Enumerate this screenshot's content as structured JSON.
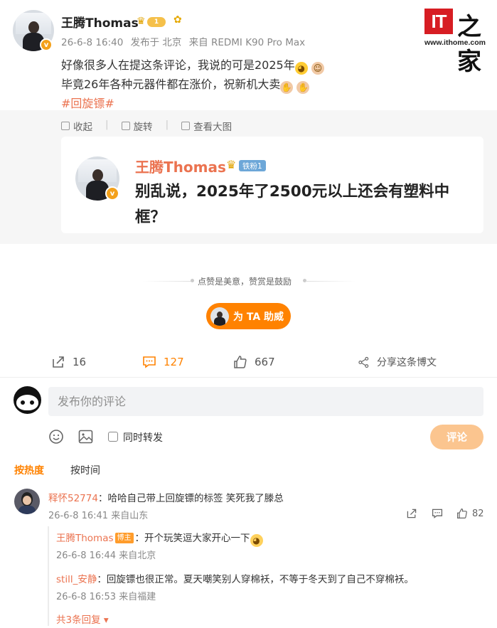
{
  "post": {
    "author": "王腾Thomas",
    "level": "1",
    "time": "26-6-8 16:40",
    "location": "发布于 北京",
    "source": "来自 REDMI K90 Pro Max",
    "line1": "好像很多人在提这条评论，我说的可是2025年",
    "line2": "毕竟26年各种元器件都在涨价，祝新机大卖",
    "hashtag": "#回旋镖#"
  },
  "logo": {
    "it": "IT",
    "zhi": "之家",
    "url": "www.ithome.com"
  },
  "repost_actions": {
    "collect": "收起",
    "rotate": "旋转",
    "view_large": "查看大图"
  },
  "quote": {
    "name": "王腾Thomas",
    "fan_badge": "铁粉1",
    "text": "别乱说，2025年了2500元以上还会有塑料中框？"
  },
  "tip": "点赞是美意，赞赏是鼓励",
  "cheer_label": "为 TA 助威",
  "stats": {
    "forward": "16",
    "comment": "127",
    "like": "667",
    "share": "分享这条博文"
  },
  "comment_box": {
    "placeholder": "发布你的评论",
    "forward_label": "同时转发",
    "submit": "评论"
  },
  "sort": {
    "hot": "按热度",
    "time": "按时间"
  },
  "comments": [
    {
      "user": "释怀52774",
      "text": "：哈哈自己带上回旋镖的标签 笑死我了滕总",
      "meta": "26-6-8 16:41 来自山东",
      "likes": "82",
      "replies": [
        {
          "user": "王腾Thomas",
          "badge": "博主",
          "text": "：开个玩笑逗大家开心一下",
          "meta": "26-6-8 16:44 来自北京"
        },
        {
          "user": "still_安静",
          "text": "：回旋镖也很正常。夏天嘲笑别人穿棉袄，不等于冬天到了自己不穿棉袄。",
          "meta": "26-6-8 16:53 来自福建"
        }
      ],
      "more": "共3条回复"
    }
  ],
  "colors": {
    "accent": "#ff8200",
    "username": "#eb7350",
    "logo_red": "#d71d23"
  }
}
